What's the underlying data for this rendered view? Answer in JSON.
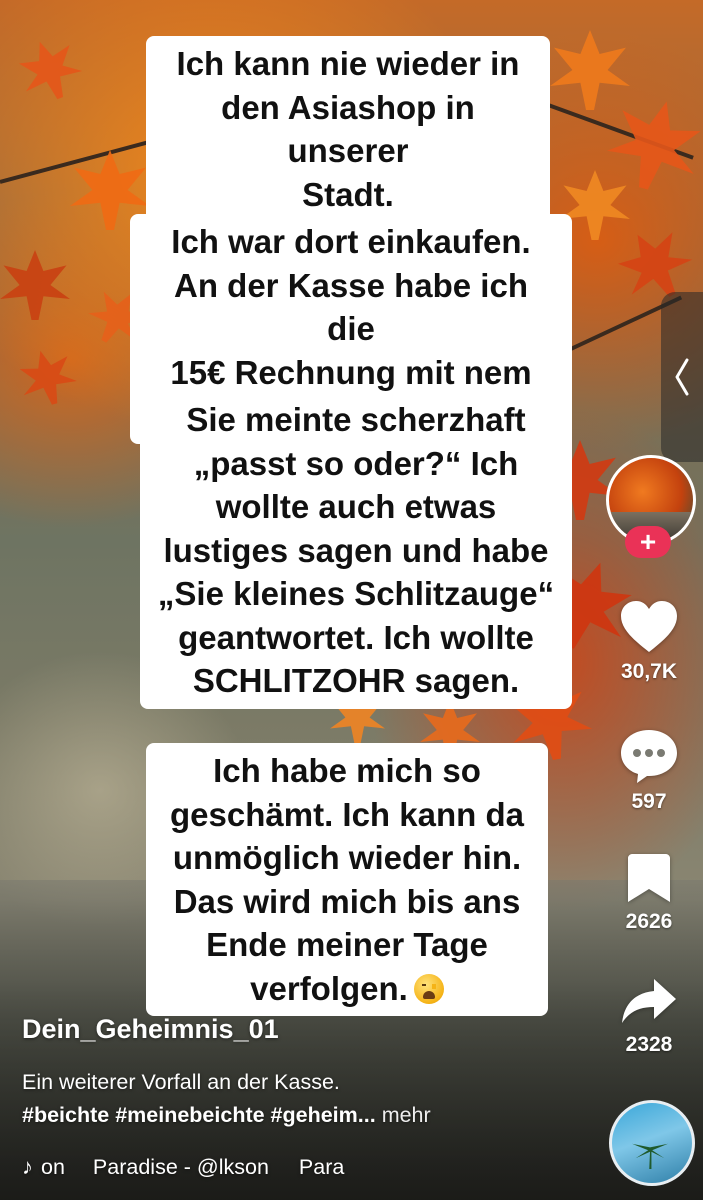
{
  "captions": [
    "Ich kann nie wieder in\nden Asiashop in unserer\nStadt.",
    "Ich war dort einkaufen.\nAn der Kasse habe ich die\n15€ Rechnung mit nem\n20er bezahlt.",
    "Sie meinte scherzhaft\n„passt so oder?“ Ich\nwollte auch etwas\nlustiges sagen und habe\n„Sie kleines Schlitzauge“\ngeantwortet. Ich wollte\nSCHLITZOHR sagen.",
    "Ich habe mich so\ngeschämt. Ich kann da\nunmöglich wieder hin.\nDas wird mich bis ans\nEnde meiner Tage\nverfolgen."
  ],
  "caption_emoji": "weary-face-emoji",
  "actions": {
    "follow_label": "+",
    "likes": "30,7K",
    "comments": "597",
    "saves": "2626",
    "shares": "2328"
  },
  "post": {
    "username": "Dein_Geheimnis_01",
    "description": "Ein weiterer Vorfall an der Kasse.",
    "hashtags": "#beichte #meinebeichte #geheim...",
    "more_label": "mehr"
  },
  "music": {
    "icon": "music-note-icon",
    "prefix": "on",
    "track": "Paradise - @lkson",
    "track_repeat": "Para"
  },
  "icons": {
    "panel_toggle": "chevron-left-icon",
    "like": "heart-icon",
    "comment": "comment-bubble-icon",
    "save": "bookmark-icon",
    "share": "share-arrow-icon"
  },
  "colors": {
    "follow_button": "#ea3257",
    "caption_bg": "#ffffff",
    "caption_text": "#111111"
  }
}
